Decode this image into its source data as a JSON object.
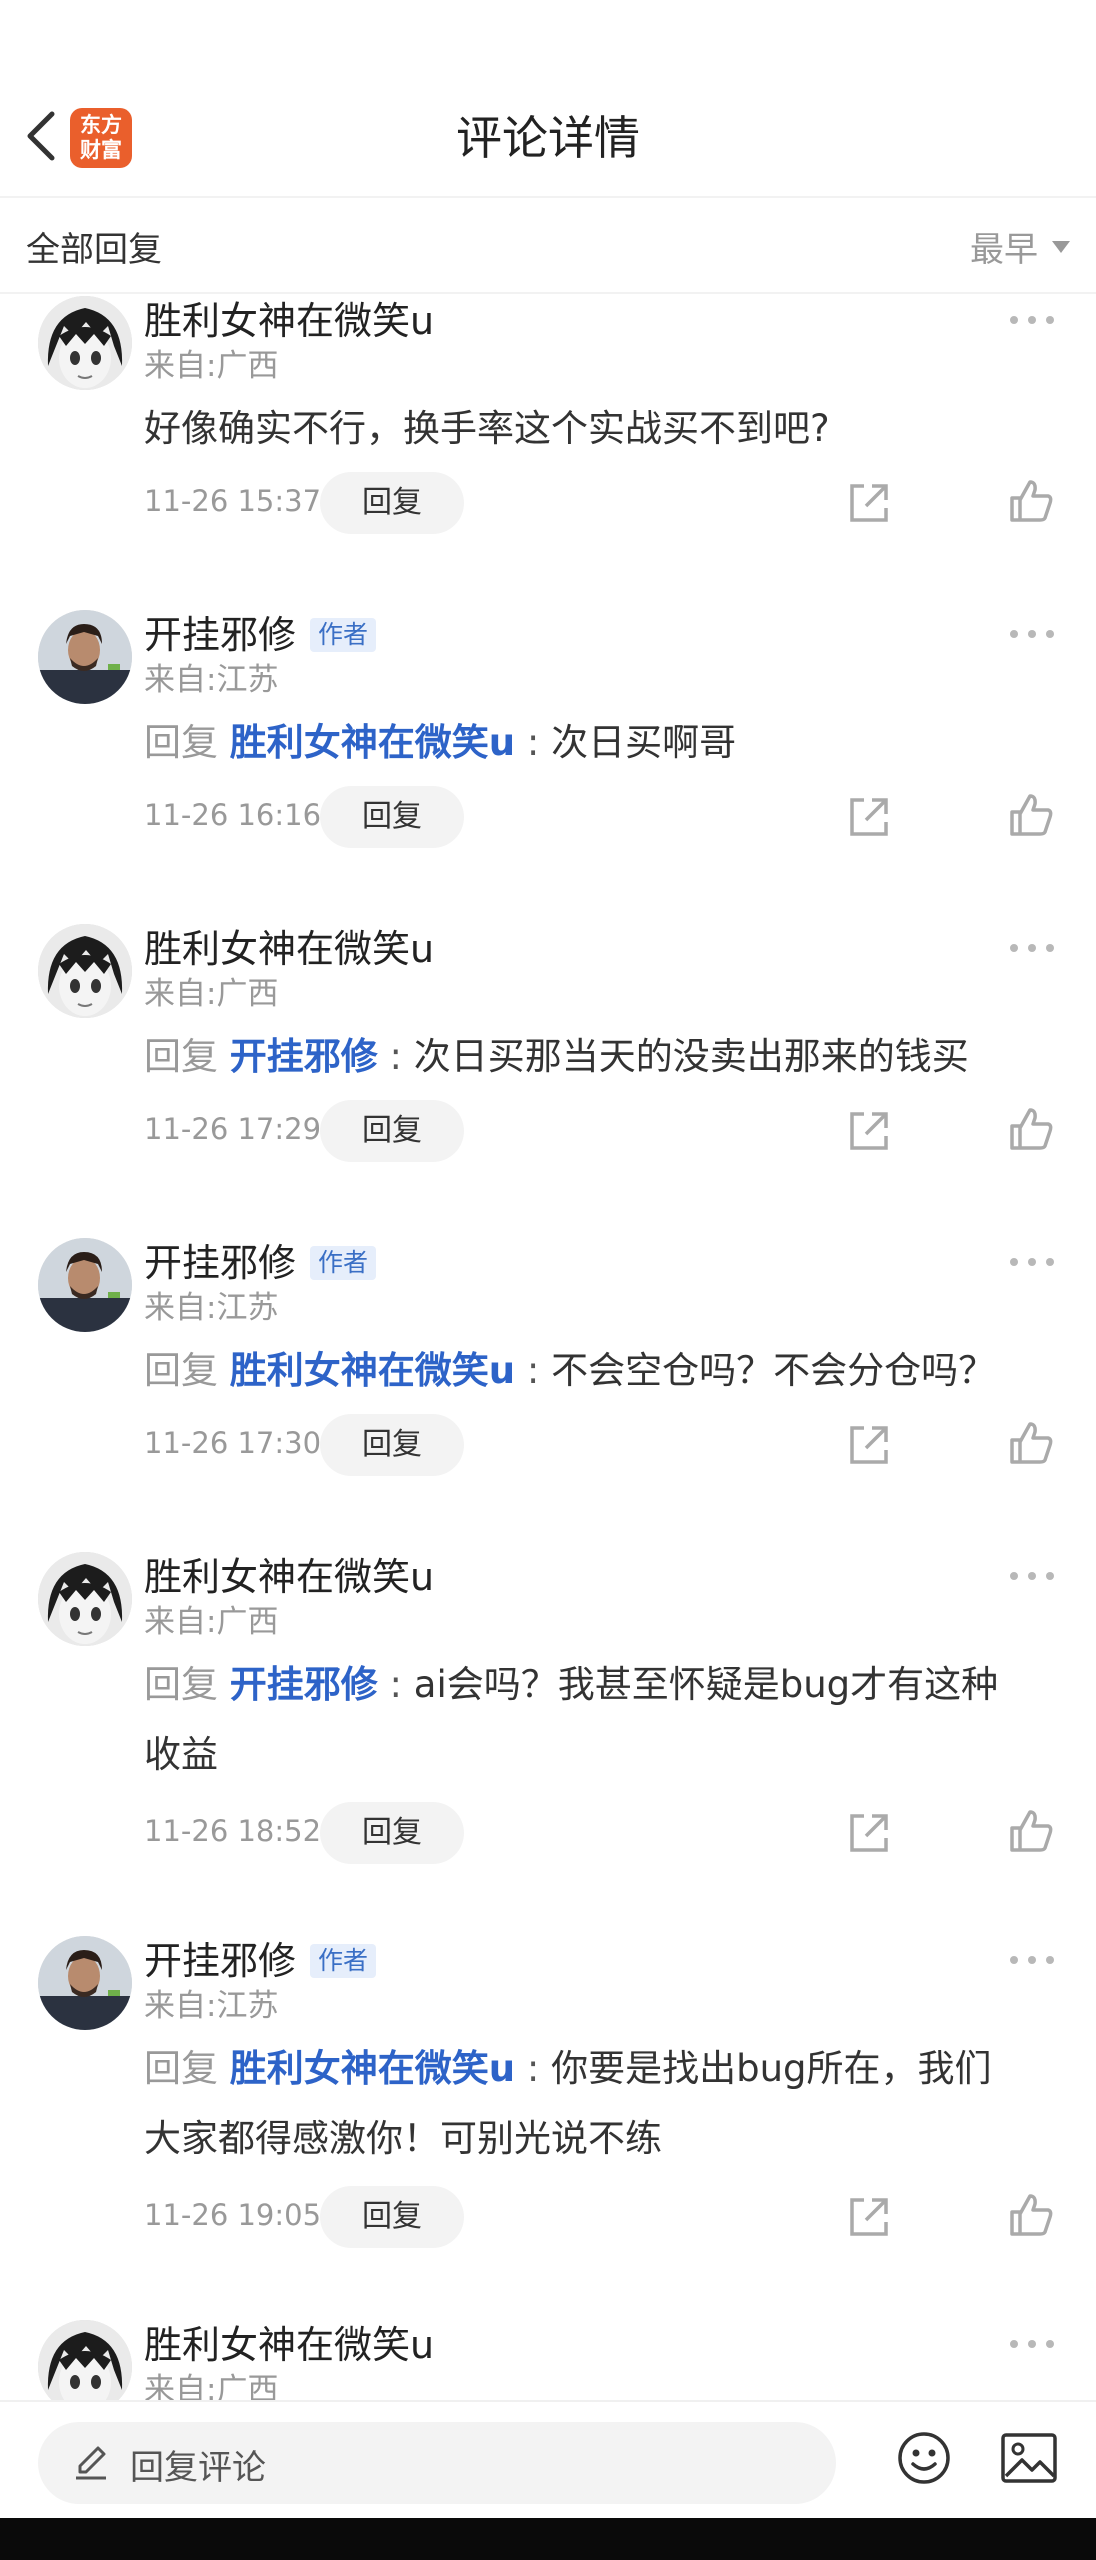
{
  "header": {
    "title": "评论详情",
    "logo_line1": "东方",
    "logo_line2": "财富"
  },
  "sortbar": {
    "all_label": "全部回复",
    "sort_label": "最早"
  },
  "comments": [
    {
      "user": "胜利女神在微笑u",
      "author_badge": "",
      "location": "来自:广西",
      "reply_prefix": "",
      "reply_to": "",
      "separator": "",
      "text": "好像确实不行，换手率这个实战买不到吧?",
      "time": "11-26 15:37",
      "reply_label": "回复"
    },
    {
      "user": "开挂邪修",
      "author_badge": "作者",
      "location": "来自:江苏",
      "reply_prefix": "回复",
      "reply_to": "胜利女神在微笑u",
      "separator": " : ",
      "text": "次日买啊哥",
      "time": "11-26 16:16",
      "reply_label": "回复"
    },
    {
      "user": "胜利女神在微笑u",
      "author_badge": "",
      "location": "来自:广西",
      "reply_prefix": "回复",
      "reply_to": "开挂邪修",
      "separator": " : ",
      "text": "次日买那当天的没卖出那来的钱买",
      "time": "11-26 17:29",
      "reply_label": "回复"
    },
    {
      "user": "开挂邪修",
      "author_badge": "作者",
      "location": "来自:江苏",
      "reply_prefix": "回复",
      "reply_to": "胜利女神在微笑u",
      "separator": " : ",
      "text": "不会空仓吗？不会分仓吗？",
      "time": "11-26 17:30",
      "reply_label": "回复"
    },
    {
      "user": "胜利女神在微笑u",
      "author_badge": "",
      "location": "来自:广西",
      "reply_prefix": "回复",
      "reply_to": "开挂邪修",
      "separator": " : ",
      "text": "ai会吗？我甚至怀疑是bug才有这种收益",
      "time": "11-26 18:52",
      "reply_label": "回复"
    },
    {
      "user": "开挂邪修",
      "author_badge": "作者",
      "location": "来自:江苏",
      "reply_prefix": "回复",
      "reply_to": "胜利女神在微笑u",
      "separator": " : ",
      "text": "你要是找出bug所在，我们大家都得感激你！可别光说不练",
      "time": "11-26 19:05",
      "reply_label": "回复"
    },
    {
      "user": "胜利女神在微笑u",
      "author_badge": "",
      "location": "来自:广西",
      "reply_prefix": "",
      "reply_to": "",
      "separator": "",
      "text": "",
      "time": "",
      "reply_label": ""
    }
  ],
  "bottombar": {
    "placeholder": "回复评论"
  },
  "colors": {
    "link_blue": "#2d63c8",
    "logo_orange": "#ea5f2c",
    "badge_bg": "#e6eefb"
  },
  "icons": {
    "back": "chevron-left-icon",
    "more": "more-dots-icon",
    "share": "share-icon",
    "like": "thumbs-up-icon",
    "pen": "pen-icon",
    "emoji": "emoji-icon",
    "image": "image-icon"
  }
}
